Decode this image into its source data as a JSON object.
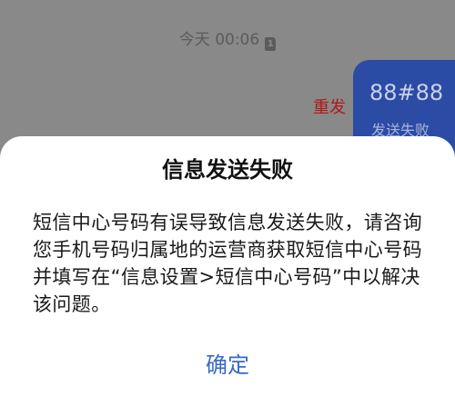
{
  "timestamp": {
    "text": "今天 00:06",
    "sim_label": "1"
  },
  "message": {
    "text": "88#88",
    "status": "发送失败"
  },
  "resend_label": "重发",
  "dialog": {
    "title": "信息发送失败",
    "body": "短信中心号码有误导致信息发送失败，请咨询您手机号码归属地的运营商获取短信中心号码并填写在“信息设置>短信中心号码”中以解决该问题。",
    "confirm_label": "确定"
  },
  "colors": {
    "overlay": "#898989",
    "bubble": "#2b4ba5",
    "resend": "#b01818",
    "accent": "#3a68c8"
  }
}
